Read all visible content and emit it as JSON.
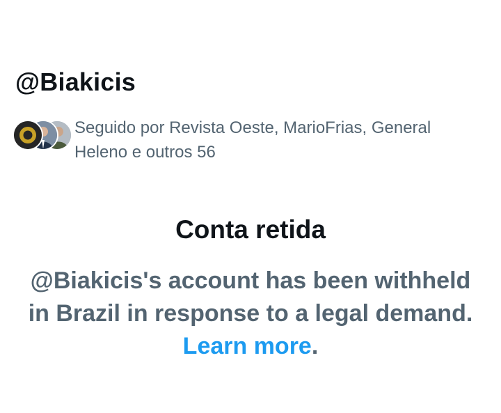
{
  "profile": {
    "handle": "@Biakicis"
  },
  "followed_by": {
    "text": "Seguido por Revista Oeste, MarioFrias, General Heleno e outros 56",
    "avatars": [
      "avatar-icon",
      "avatar-icon",
      "avatar-icon"
    ]
  },
  "withheld_notice": {
    "title": "Conta retida",
    "message": "@Biakicis's account has been withheld in Brazil in response to a legal demand.",
    "link_label": "Learn more",
    "trailing": ".",
    "link_color": "#1d9bf0",
    "text_color": "#536471"
  }
}
